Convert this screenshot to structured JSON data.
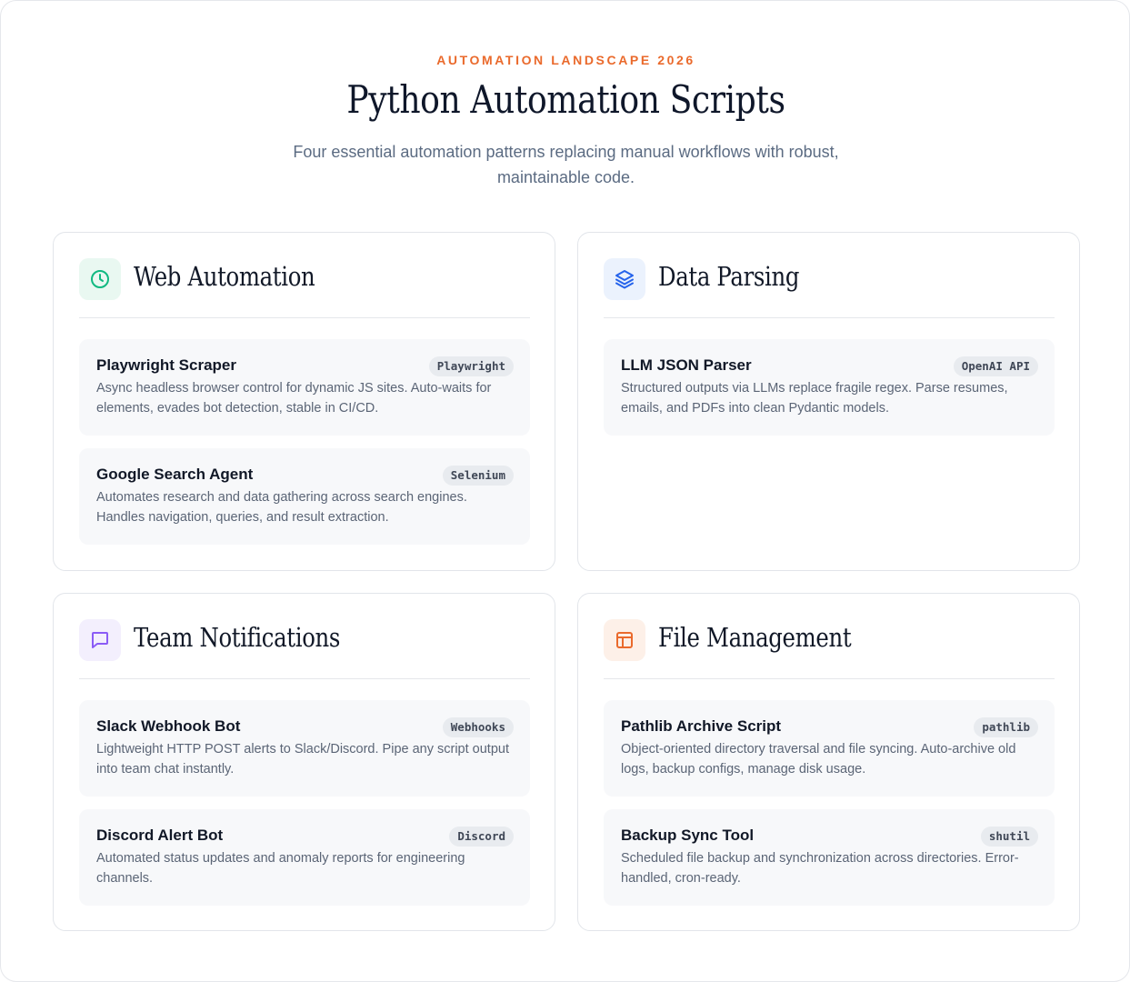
{
  "header": {
    "eyebrow": "AUTOMATION LANDSCAPE 2026",
    "title": "Python Automation Scripts",
    "subtitle": "Four essential automation patterns replacing manual workflows with robust, maintainable code."
  },
  "colors": {
    "accent": "#ea6a2c",
    "web_icon": "#10b981",
    "data_icon": "#2563eb",
    "team_icon": "#8b5cf6",
    "file_icon": "#ea6a2c"
  },
  "cards": [
    {
      "title": "Web Automation",
      "icon": "clock-icon",
      "items": [
        {
          "title": "Playwright Scraper",
          "tag": "Playwright",
          "description": "Async headless browser control for dynamic JS sites. Auto-waits for elements, evades bot detection, stable in CI/CD."
        },
        {
          "title": "Google Search Agent",
          "tag": "Selenium",
          "description": "Automates research and data gathering across search engines. Handles navigation, queries, and result extraction."
        }
      ]
    },
    {
      "title": "Data Parsing",
      "icon": "layers-icon",
      "items": [
        {
          "title": "LLM JSON Parser",
          "tag": "OpenAI API",
          "description": "Structured outputs via LLMs replace fragile regex. Parse resumes, emails, and PDFs into clean Pydantic models."
        }
      ]
    },
    {
      "title": "Team Notifications",
      "icon": "message-icon",
      "items": [
        {
          "title": "Slack Webhook Bot",
          "tag": "Webhooks",
          "description": "Lightweight HTTP POST alerts to Slack/Discord. Pipe any script output into team chat instantly."
        },
        {
          "title": "Discord Alert Bot",
          "tag": "Discord",
          "description": "Automated status updates and anomaly reports for engineering channels."
        }
      ]
    },
    {
      "title": "File Management",
      "icon": "layout-icon",
      "items": [
        {
          "title": "Pathlib Archive Script",
          "tag": "pathlib",
          "description": "Object-oriented directory traversal and file syncing. Auto-archive old logs, backup configs, manage disk usage."
        },
        {
          "title": "Backup Sync Tool",
          "tag": "shutil",
          "description": "Scheduled file backup and synchronization across directories. Error-handled, cron-ready."
        }
      ]
    }
  ]
}
